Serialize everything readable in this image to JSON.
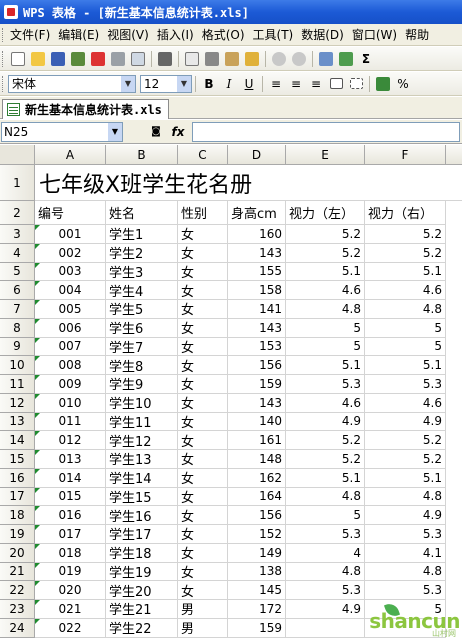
{
  "window": {
    "title": "WPS 表格 - [新生基本信息统计表.xls]"
  },
  "menu": [
    "文件(F)",
    "编辑(E)",
    "视图(V)",
    "插入(I)",
    "格式(O)",
    "工具(T)",
    "数据(D)",
    "窗口(W)",
    "帮助"
  ],
  "format_toolbar": {
    "font_name": "宋体",
    "font_size": "12",
    "bold": "B",
    "italic": "I",
    "underline": "U",
    "percent": "%"
  },
  "tab": {
    "filename": "新生基本信息统计表.xls"
  },
  "formula_bar": {
    "cell_ref": "N25",
    "fx": "fx"
  },
  "columns": [
    "A",
    "B",
    "C",
    "D",
    "E",
    "F"
  ],
  "sheet_title": "七年级X班学生花名册",
  "headers": [
    "编号",
    "姓名",
    "性别",
    "身高cm",
    "视力（左）",
    "视力（右）"
  ],
  "rows": [
    {
      "row": "3",
      "id": "001",
      "name": "学生1",
      "sex": "女",
      "height": "160",
      "left": "5.2",
      "right": "5.2"
    },
    {
      "row": "4",
      "id": "002",
      "name": "学生2",
      "sex": "女",
      "height": "143",
      "left": "5.2",
      "right": "5.2"
    },
    {
      "row": "5",
      "id": "003",
      "name": "学生3",
      "sex": "女",
      "height": "155",
      "left": "5.1",
      "right": "5.1"
    },
    {
      "row": "6",
      "id": "004",
      "name": "学生4",
      "sex": "女",
      "height": "158",
      "left": "4.6",
      "right": "4.6"
    },
    {
      "row": "7",
      "id": "005",
      "name": "学生5",
      "sex": "女",
      "height": "141",
      "left": "4.8",
      "right": "4.8"
    },
    {
      "row": "8",
      "id": "006",
      "name": "学生6",
      "sex": "女",
      "height": "143",
      "left": "5",
      "right": "5"
    },
    {
      "row": "9",
      "id": "007",
      "name": "学生7",
      "sex": "女",
      "height": "153",
      "left": "5",
      "right": "5"
    },
    {
      "row": "10",
      "id": "008",
      "name": "学生8",
      "sex": "女",
      "height": "156",
      "left": "5.1",
      "right": "5.1"
    },
    {
      "row": "11",
      "id": "009",
      "name": "学生9",
      "sex": "女",
      "height": "159",
      "left": "5.3",
      "right": "5.3"
    },
    {
      "row": "12",
      "id": "010",
      "name": "学生10",
      "sex": "女",
      "height": "143",
      "left": "4.6",
      "right": "4.6"
    },
    {
      "row": "13",
      "id": "011",
      "name": "学生11",
      "sex": "女",
      "height": "140",
      "left": "4.9",
      "right": "4.9"
    },
    {
      "row": "14",
      "id": "012",
      "name": "学生12",
      "sex": "女",
      "height": "161",
      "left": "5.2",
      "right": "5.2"
    },
    {
      "row": "15",
      "id": "013",
      "name": "学生13",
      "sex": "女",
      "height": "148",
      "left": "5.2",
      "right": "5.2"
    },
    {
      "row": "16",
      "id": "014",
      "name": "学生14",
      "sex": "女",
      "height": "162",
      "left": "5.1",
      "right": "5.1"
    },
    {
      "row": "17",
      "id": "015",
      "name": "学生15",
      "sex": "女",
      "height": "164",
      "left": "4.8",
      "right": "4.8"
    },
    {
      "row": "18",
      "id": "016",
      "name": "学生16",
      "sex": "女",
      "height": "156",
      "left": "5",
      "right": "4.9"
    },
    {
      "row": "19",
      "id": "017",
      "name": "学生17",
      "sex": "女",
      "height": "152",
      "left": "5.3",
      "right": "5.3"
    },
    {
      "row": "20",
      "id": "018",
      "name": "学生18",
      "sex": "女",
      "height": "149",
      "left": "4",
      "right": "4.1"
    },
    {
      "row": "21",
      "id": "019",
      "name": "学生19",
      "sex": "女",
      "height": "138",
      "left": "4.8",
      "right": "4.8"
    },
    {
      "row": "22",
      "id": "020",
      "name": "学生20",
      "sex": "女",
      "height": "145",
      "left": "5.3",
      "right": "5.3"
    },
    {
      "row": "23",
      "id": "021",
      "name": "学生21",
      "sex": "男",
      "height": "172",
      "left": "4.9",
      "right": "5"
    },
    {
      "row": "24",
      "id": "022",
      "name": "学生22",
      "sex": "男",
      "height": "159",
      "left": "",
      "right": ""
    }
  ],
  "watermark": {
    "text": "shancun",
    "sub": "山村网"
  },
  "colors": {
    "titlebar": "#1c5ad6",
    "chrome": "#f1efe2",
    "comment_marker": "#1f8b2f"
  }
}
